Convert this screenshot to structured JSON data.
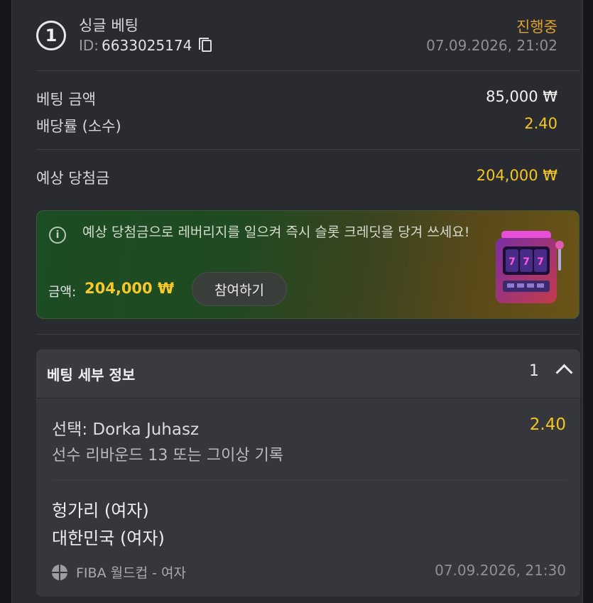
{
  "header": {
    "leg_number": "1",
    "title": "싱글 베팅",
    "id_label": "ID:",
    "id_value": "6633025174",
    "status": "진행중",
    "datetime": "07.09.2026, 21:02"
  },
  "summary": {
    "stake_label": "베팅 금액",
    "stake_value": "85,000 ₩",
    "odds_label": "배당률 (소수)",
    "odds_value": "2.40",
    "payout_label": "예상 당첨금",
    "payout_value": "204,000 ₩"
  },
  "promo": {
    "text": "예상 당첨금으로 레버리지를 일으켜 즉시 슬롯 크레딧을 당겨 쓰세요!",
    "amount_label": "금액:",
    "amount_value": "204,000 ₩",
    "button_label": "참여하기",
    "slot_digits": "777"
  },
  "details": {
    "title": "베팅 세부 정보",
    "count": "1",
    "selection": "선택: Dorka Juhasz",
    "selection_odds": "2.40",
    "market": "선수 리바운드 13 또는 그이상 기록",
    "home_team": "헝가리 (여자)",
    "away_team": "대한민국 (여자)",
    "league": "FIBA 월드컵 - 여자",
    "match_time": "07.09.2026, 21:30"
  },
  "colors": {
    "status": "#e0a12d",
    "accent_yellow": "#f3c623",
    "background": "#2a2b30"
  }
}
